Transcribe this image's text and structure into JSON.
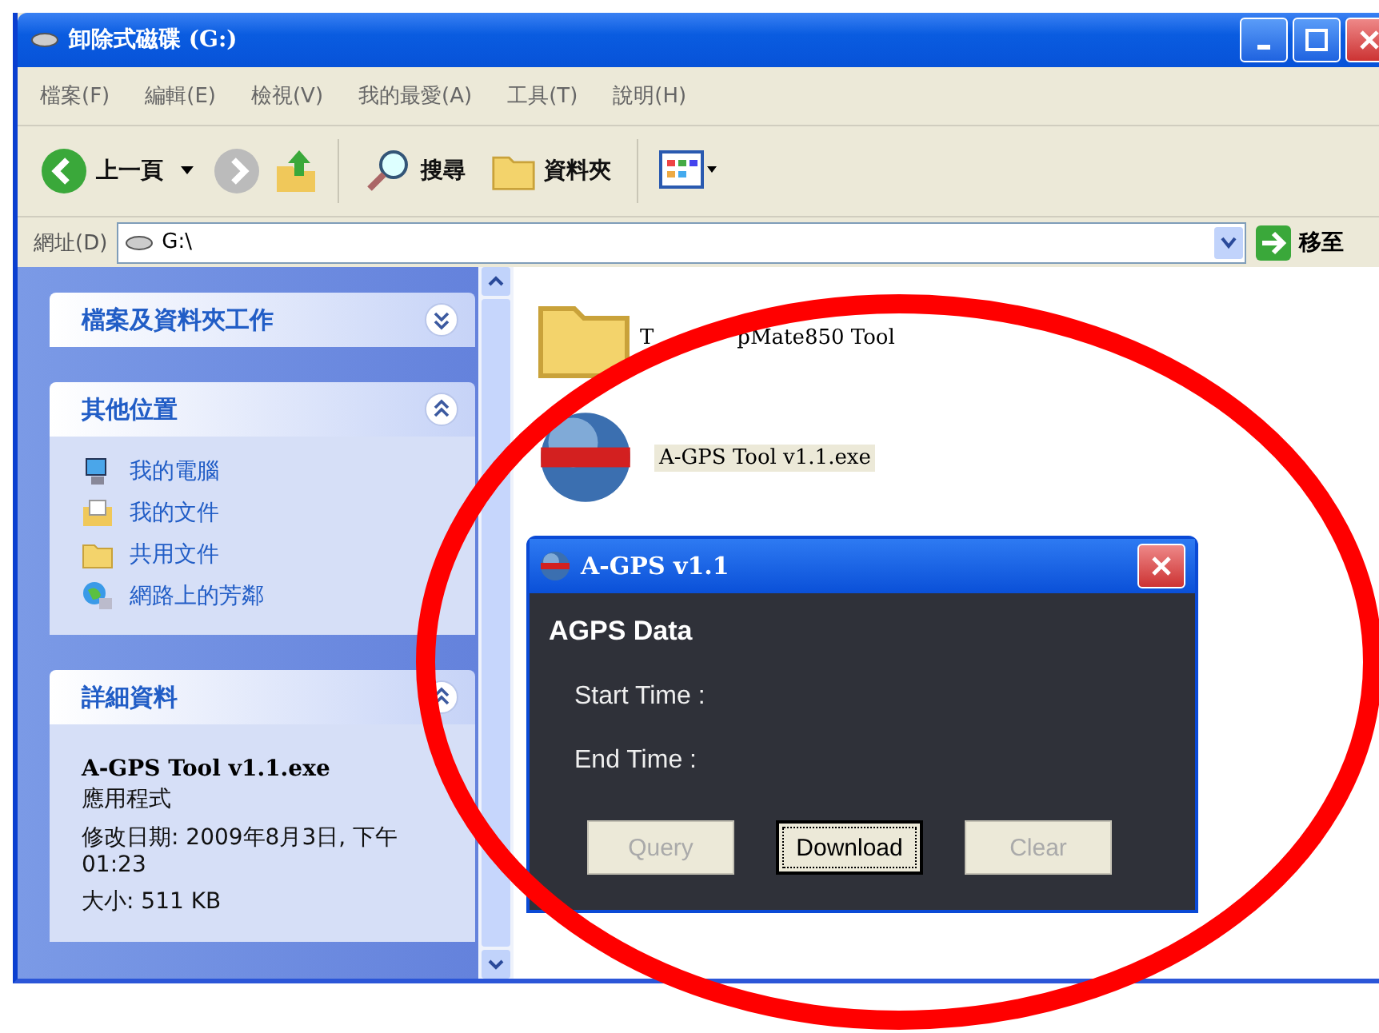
{
  "window": {
    "title": "卸除式磁碟 (G:)"
  },
  "menu": [
    "檔案(F)",
    "編輯(E)",
    "檢視(V)",
    "我的最愛(A)",
    "工具(T)",
    "說明(H)"
  ],
  "toolbar": {
    "back": "上一頁",
    "search": "搜尋",
    "folders": "資料夾"
  },
  "address": {
    "label": "網址(D)",
    "value": "G:\\",
    "go": "移至"
  },
  "task_pane": [
    {
      "title": "檔案及資料夾工作",
      "expanded": false
    },
    {
      "title": "其他位置",
      "expanded": true,
      "items": [
        {
          "label": "我的電腦",
          "kind": "computer"
        },
        {
          "label": "我的文件",
          "kind": "documents"
        },
        {
          "label": "共用文件",
          "kind": "folder"
        },
        {
          "label": "網路上的芳鄰",
          "kind": "network"
        }
      ]
    },
    {
      "title": "詳細資料",
      "expanded": true,
      "details": {
        "name": "A-GPS Tool v1.1.exe",
        "type": "應用程式",
        "modified": "修改日期: 2009年8月3日, 下午 01:23",
        "size": "大小: 511 KB"
      }
    }
  ],
  "files": [
    {
      "name": "T",
      "name_after_cover": "pMate850 Tool",
      "kind": "folder",
      "selected": false
    },
    {
      "name": "A-GPS Tool v1.1.exe",
      "kind": "app",
      "selected": true
    }
  ],
  "dialog": {
    "title": "A-GPS v1.1",
    "heading": "AGPS Data",
    "fields": [
      "Start Time :",
      "End Time :"
    ],
    "buttons": [
      {
        "label": "Query",
        "disabled": true,
        "focused": false
      },
      {
        "label": "Download",
        "disabled": false,
        "focused": true
      },
      {
        "label": "Clear",
        "disabled": true,
        "focused": false
      }
    ]
  },
  "annotation": {
    "kind": "ellipse",
    "color": "#ff0000"
  }
}
